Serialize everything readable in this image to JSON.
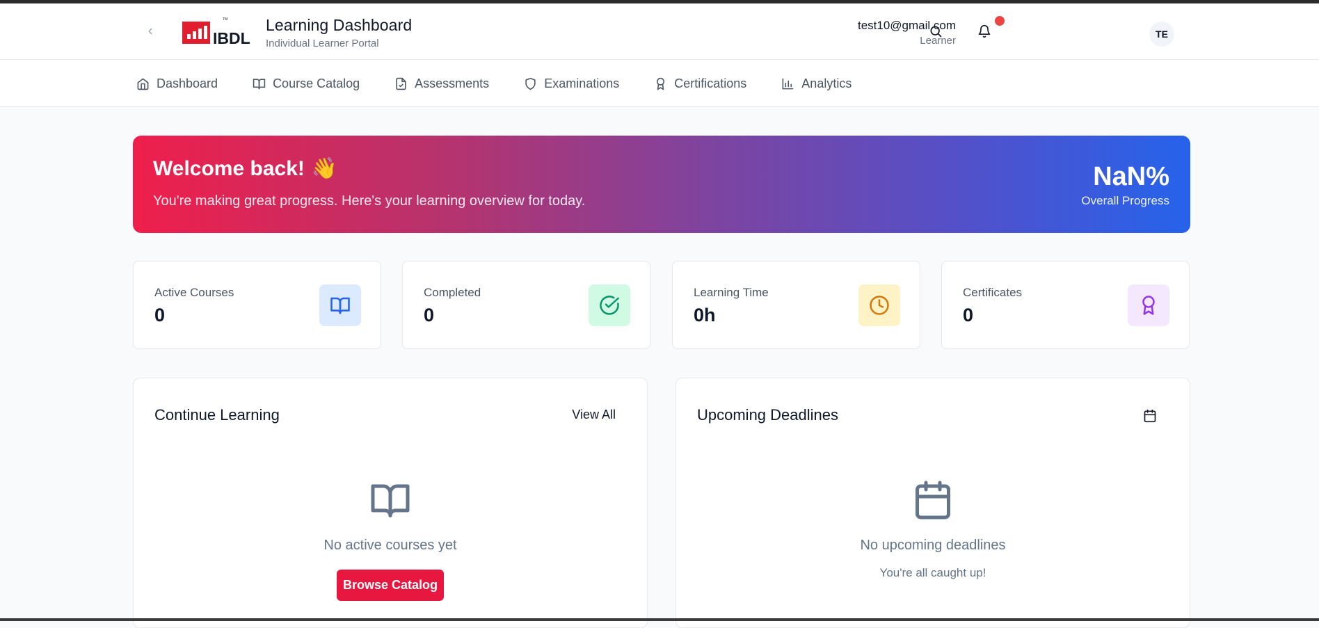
{
  "header": {
    "title": "Learning Dashboard",
    "subtitle": "Individual Learner Portal",
    "logo_text": "IBDL",
    "user_email": "test10@gmail.com",
    "user_role": "Learner",
    "avatar_initials": "TE"
  },
  "nav": {
    "items": [
      {
        "label": "Dashboard",
        "icon": "home-icon"
      },
      {
        "label": "Course Catalog",
        "icon": "book-icon"
      },
      {
        "label": "Assessments",
        "icon": "file-check-icon"
      },
      {
        "label": "Examinations",
        "icon": "shield-icon"
      },
      {
        "label": "Certifications",
        "icon": "award-icon"
      },
      {
        "label": "Analytics",
        "icon": "bar-chart-icon"
      }
    ]
  },
  "banner": {
    "title": "Welcome back!",
    "emoji": "👋",
    "subtitle": "You're making great progress. Here's your learning overview for today.",
    "progress_value": "NaN%",
    "progress_label": "Overall Progress"
  },
  "stats": [
    {
      "label": "Active Courses",
      "value": "0",
      "icon": "book-open-icon",
      "bg": "#dbeafe",
      "color": "#2563eb"
    },
    {
      "label": "Completed",
      "value": "0",
      "icon": "check-circle-icon",
      "bg": "#d1fae5",
      "color": "#059669"
    },
    {
      "label": "Learning Time",
      "value": "0h",
      "icon": "clock-icon",
      "bg": "#fef3c7",
      "color": "#d97706"
    },
    {
      "label": "Certificates",
      "value": "0",
      "icon": "award-icon",
      "bg": "#f3e8ff",
      "color": "#9333ea"
    }
  ],
  "continue_learning": {
    "title": "Continue Learning",
    "view_all": "View All",
    "empty_text": "No active courses yet",
    "button": "Browse Catalog"
  },
  "deadlines": {
    "title": "Upcoming Deadlines",
    "empty_text": "No upcoming deadlines",
    "empty_sub": "You're all caught up!"
  },
  "colors": {
    "accent": "#e8173f",
    "gradient_start": "#ef1f4b",
    "gradient_end": "#2563eb"
  }
}
